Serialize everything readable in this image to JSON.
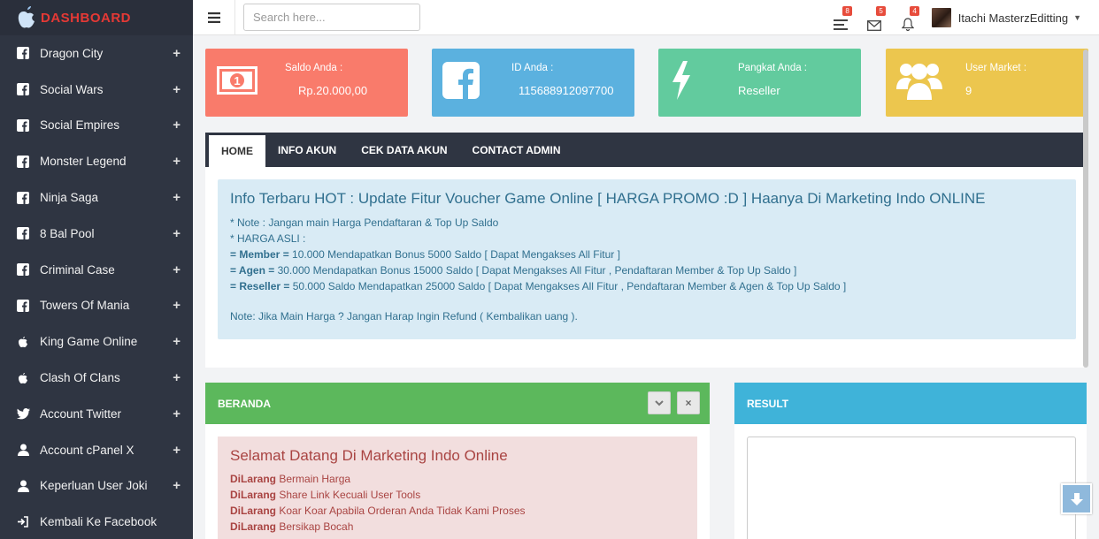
{
  "brand": {
    "name": "DASHBOARD"
  },
  "sidebar": {
    "items": [
      {
        "label": "Dragon City",
        "icon": "facebook-icon"
      },
      {
        "label": "Social Wars",
        "icon": "facebook-icon"
      },
      {
        "label": "Social Empires",
        "icon": "facebook-icon"
      },
      {
        "label": "Monster Legend",
        "icon": "facebook-icon"
      },
      {
        "label": "Ninja Saga",
        "icon": "facebook-icon"
      },
      {
        "label": "8 Bal Pool",
        "icon": "facebook-icon"
      },
      {
        "label": "Criminal Case",
        "icon": "facebook-icon"
      },
      {
        "label": "Towers Of Mania",
        "icon": "facebook-icon"
      },
      {
        "label": "King Game Online",
        "icon": "apple-icon"
      },
      {
        "label": "Clash Of Clans",
        "icon": "apple-icon"
      },
      {
        "label": "Account Twitter",
        "icon": "twitter-icon"
      },
      {
        "label": "Account cPanel X",
        "icon": "user-icon"
      },
      {
        "label": "Keperluan User Joki",
        "icon": "user-icon"
      },
      {
        "label": "Kembali Ke Facebook",
        "icon": "sign-in-icon"
      }
    ],
    "expand": "+"
  },
  "topbar": {
    "search_placeholder": "Search here...",
    "badges": {
      "tasks": "8",
      "messages": "5",
      "notifications": "4"
    },
    "user_name": "Itachi MasterzEditting"
  },
  "cards": {
    "saldo": {
      "label": "Saldo Anda :",
      "value": "Rp.20.000,00",
      "color": "#f97b6b"
    },
    "id": {
      "label": "ID Anda :",
      "value": "115688912097700",
      "color": "#5bb1df"
    },
    "pangkat": {
      "label": "Pangkat Anda :",
      "value": "Reseller",
      "color": "#62cb9e"
    },
    "market": {
      "label": "User Market :",
      "value": "9",
      "color": "#ecc64e"
    }
  },
  "tabs": [
    "HOME",
    "INFO AKUN",
    "CEK DATA AKUN",
    "CONTACT ADMIN"
  ],
  "info": {
    "title": "Info Terbaru HOT : Update Fitur Voucher Game Online [ HARGA PROMO :D ] Haanya Di Marketing Indo ONLINE",
    "note": "* Note : Jangan main Harga Pendaftaran & Top Up Saldo",
    "harga": "* HARGA ASLI :",
    "member_label": "= Member =",
    "member_text": " 10.000 Mendapatkan Bonus 5000 Saldo [ Dapat Mengakses All Fitur ]",
    "agen_label": "= Agen =",
    "agen_text": " 30.000 Mendapatkan Bonus 15000 Saldo [ Dapat Mengakses All Fitur , Pendaftaran Member & Top Up Saldo ]",
    "reseller_label": "= Reseller =",
    "reseller_text": " 50.000 Saldo Mendapatkan 25000 Saldo [ Dapat Mengakses All Fitur , Pendaftaran Member & Agen & Top Up Saldo ]",
    "footer": "Note: Jika Main Harga ? Jangan Harap Ingin Refund ( Kembalikan uang )."
  },
  "beranda": {
    "title": "BERANDA",
    "color": "#5cb85c",
    "welcome": "Selamat Datang Di Marketing Indo Online",
    "rules": [
      {
        "label": "DiLarang",
        "text": " Bermain Harga"
      },
      {
        "label": "DiLarang",
        "text": " Share Link Kecuali User Tools"
      },
      {
        "label": "DiLarang",
        "text": " Koar Koar Apabila Orderan Anda Tidak Kami Proses"
      },
      {
        "label": "DiLarang",
        "text": " Bersikap Bocah"
      }
    ]
  },
  "result": {
    "title": "RESULT",
    "color": "#3fb3d9"
  }
}
